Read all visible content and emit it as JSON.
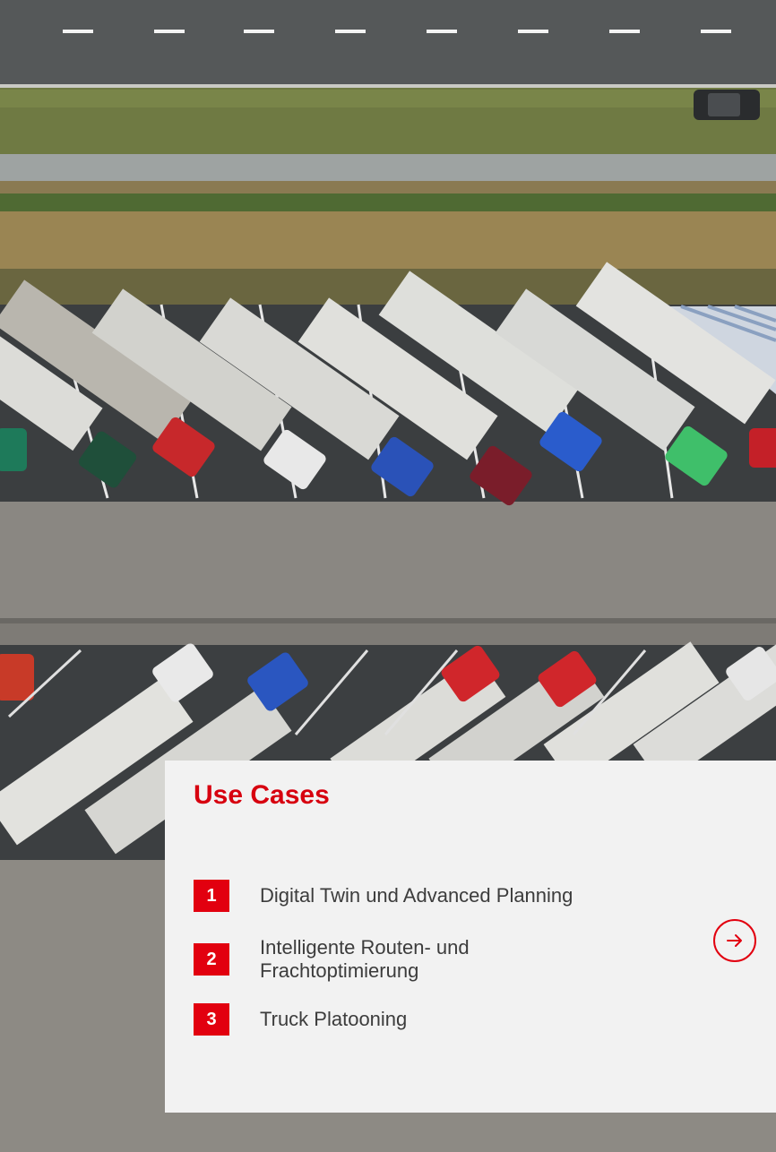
{
  "card": {
    "title": "Use Cases",
    "items": [
      {
        "number": "1",
        "label": "Digital Twin und Advanced Planning"
      },
      {
        "number": "2",
        "label": "Intelligente Routen- und Frachtoptimierung"
      },
      {
        "number": "3",
        "label": "Truck Platooning"
      }
    ],
    "next_icon": "arrow-right-icon"
  },
  "colors": {
    "accent": "#e2000f",
    "title": "#d7000f",
    "card_background": "#f2f2f2",
    "text": "#3c3c3c"
  }
}
